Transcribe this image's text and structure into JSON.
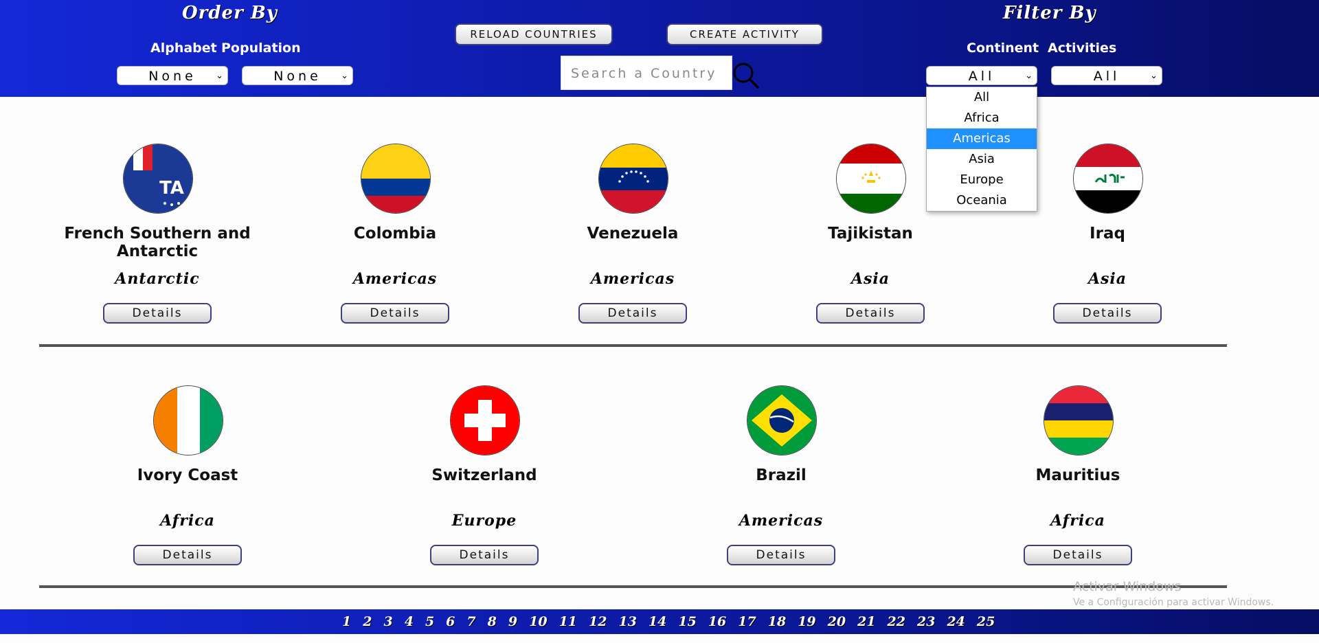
{
  "header": {
    "order_title": "Order By",
    "order_alphabet_label": "Alphabet",
    "order_population_label": "Population",
    "order_alphabet_value": "None",
    "order_population_value": "None",
    "reload_label": "RELOAD COUNTRIES",
    "create_label": "CREATE ACTIVITY",
    "search_placeholder": "Search a Country",
    "filter_title": "Filter By",
    "filter_continent_label": "Continent",
    "filter_activities_label": "Activities",
    "filter_continent_value": "All",
    "filter_activities_value": "All"
  },
  "continent_dropdown": {
    "options": [
      "All",
      "Africa",
      "Americas",
      "Asia",
      "Europe",
      "Oceania"
    ],
    "highlighted": "Americas"
  },
  "countries": [
    {
      "name": "French Southern and Antarctic",
      "continent": "Antarctic",
      "flag": "french-southern-antarctic-flag"
    },
    {
      "name": "Colombia",
      "continent": "Americas",
      "flag": "colombia-flag"
    },
    {
      "name": "Venezuela",
      "continent": "Americas",
      "flag": "venezuela-flag"
    },
    {
      "name": "Tajikistan",
      "continent": "Asia",
      "flag": "tajikistan-flag"
    },
    {
      "name": "Iraq",
      "continent": "Asia",
      "flag": "iraq-flag"
    },
    {
      "name": "Ivory Coast",
      "continent": "Africa",
      "flag": "ivory-coast-flag"
    },
    {
      "name": "Switzerland",
      "continent": "Europe",
      "flag": "switzerland-flag"
    },
    {
      "name": "Brazil",
      "continent": "Americas",
      "flag": "brazil-flag"
    },
    {
      "name": "Mauritius",
      "continent": "Africa",
      "flag": "mauritius-flag"
    }
  ],
  "details_label": "Details",
  "pagination": [
    "1",
    "2",
    "3",
    "4",
    "5",
    "6",
    "7",
    "8",
    "9",
    "10",
    "11",
    "12",
    "13",
    "14",
    "15",
    "16",
    "17",
    "18",
    "19",
    "20",
    "21",
    "22",
    "23",
    "24",
    "25"
  ],
  "watermark": {
    "line1": "Activar Windows",
    "line2": "Ve a Configuración para activar Windows."
  },
  "colors": {
    "header_gradient_start": "#1428d8",
    "header_gradient_end": "#060d63",
    "dropdown_highlight": "#1e90ff"
  }
}
